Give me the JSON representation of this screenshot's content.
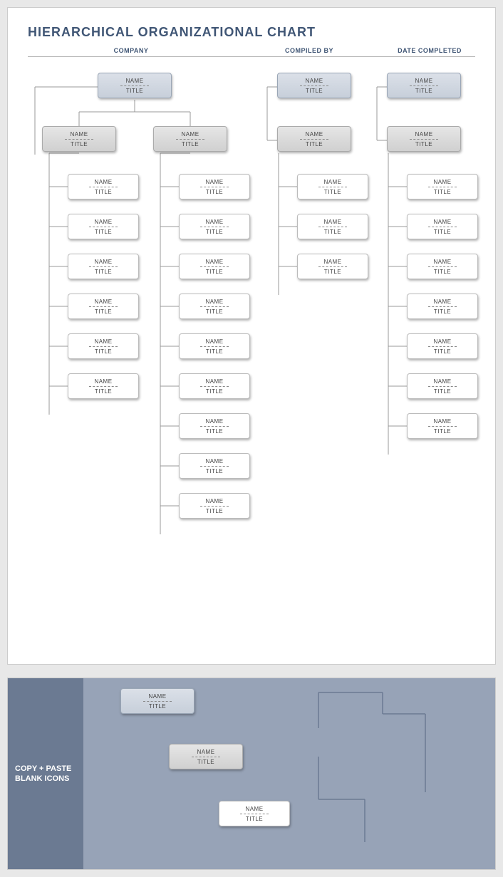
{
  "title": "HIERARCHICAL ORGANIZATIONAL CHART",
  "header": {
    "company": "COMPANY",
    "compiled_by": "COMPILED BY",
    "date_completed": "DATE COMPLETED"
  },
  "labels": {
    "name": "NAME",
    "title": "TITLE"
  },
  "panel2": {
    "label": "COPY + PASTE BLANK ICONS"
  },
  "chart_data": {
    "type": "org_chart",
    "columns": [
      {
        "top_box": {
          "name": "NAME",
          "title": "TITLE",
          "style": "blue",
          "span": 2
        },
        "mid_boxes": [
          {
            "name": "NAME",
            "title": "TITLE",
            "style": "grey"
          },
          {
            "name": "NAME",
            "title": "TITLE",
            "style": "grey"
          }
        ],
        "children": [
          [
            {
              "name": "NAME",
              "title": "TITLE"
            },
            {
              "name": "NAME",
              "title": "TITLE"
            },
            {
              "name": "NAME",
              "title": "TITLE"
            },
            {
              "name": "NAME",
              "title": "TITLE"
            },
            {
              "name": "NAME",
              "title": "TITLE"
            },
            {
              "name": "NAME",
              "title": "TITLE"
            }
          ],
          [
            {
              "name": "NAME",
              "title": "TITLE"
            },
            {
              "name": "NAME",
              "title": "TITLE"
            },
            {
              "name": "NAME",
              "title": "TITLE"
            },
            {
              "name": "NAME",
              "title": "TITLE"
            },
            {
              "name": "NAME",
              "title": "TITLE"
            },
            {
              "name": "NAME",
              "title": "TITLE"
            },
            {
              "name": "NAME",
              "title": "TITLE"
            },
            {
              "name": "NAME",
              "title": "TITLE"
            },
            {
              "name": "NAME",
              "title": "TITLE"
            }
          ]
        ]
      },
      {
        "top_box": {
          "name": "NAME",
          "title": "TITLE",
          "style": "blue",
          "span": 1
        },
        "mid_boxes": [
          {
            "name": "NAME",
            "title": "TITLE",
            "style": "grey"
          }
        ],
        "children": [
          [
            {
              "name": "NAME",
              "title": "TITLE"
            },
            {
              "name": "NAME",
              "title": "TITLE"
            },
            {
              "name": "NAME",
              "title": "TITLE"
            }
          ]
        ]
      },
      {
        "top_box": {
          "name": "NAME",
          "title": "TITLE",
          "style": "blue",
          "span": 1
        },
        "mid_boxes": [
          {
            "name": "NAME",
            "title": "TITLE",
            "style": "grey"
          }
        ],
        "children": [
          [
            {
              "name": "NAME",
              "title": "TITLE"
            },
            {
              "name": "NAME",
              "title": "TITLE"
            },
            {
              "name": "NAME",
              "title": "TITLE"
            },
            {
              "name": "NAME",
              "title": "TITLE"
            },
            {
              "name": "NAME",
              "title": "TITLE"
            },
            {
              "name": "NAME",
              "title": "TITLE"
            },
            {
              "name": "NAME",
              "title": "TITLE"
            }
          ]
        ]
      }
    ],
    "palette_boxes": [
      {
        "name": "NAME",
        "title": "TITLE",
        "style": "blue"
      },
      {
        "name": "NAME",
        "title": "TITLE",
        "style": "grey"
      },
      {
        "name": "NAME",
        "title": "TITLE",
        "style": "white"
      }
    ]
  }
}
